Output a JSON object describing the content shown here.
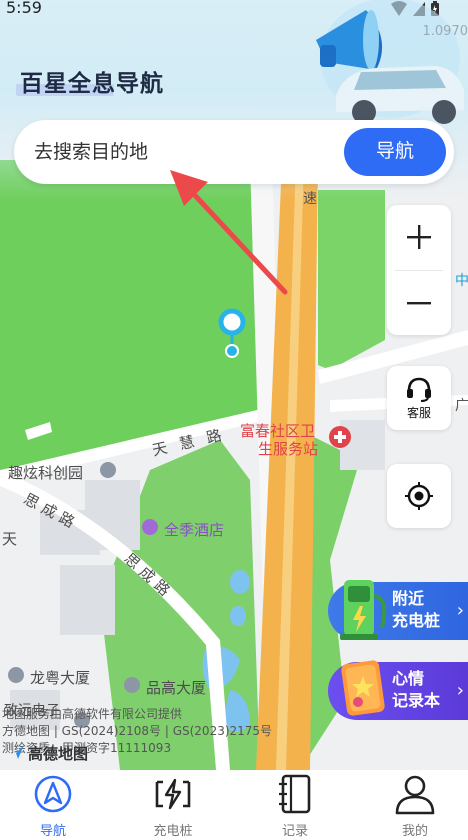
{
  "status_bar": {
    "time": "5:59"
  },
  "app": {
    "title": "百星全息导航",
    "version_text": "1.0970"
  },
  "search": {
    "placeholder": "去搜索目的地",
    "nav_button": "导航"
  },
  "map_controls": {
    "zoom_in": "+",
    "zoom_out": "−",
    "service_label": "客服"
  },
  "promos": {
    "charging": {
      "line1": "附近",
      "line2": "充电桩"
    },
    "mood": {
      "line1": "心情",
      "line2": "记录本"
    }
  },
  "map_labels": {
    "road_speed": "速",
    "tianhui_road": "天 慧 路",
    "fuchun_clinic_1": "富春社区卫",
    "fuchun_clinic_2": "生服务站",
    "quxuan_park": "趣炫科创园",
    "sicheng_road_1": "思成路",
    "sicheng_road_2": "思成路",
    "sicheng_road_3": "思成路",
    "tian_road": "天",
    "quanji_hotel": "全季酒店",
    "longyue_building": "龙粤大厦",
    "pingao_building": "品高大厦",
    "zhiyuan_electronics": "致远电子",
    "right_edge_1": "中",
    "right_edge_2": "广"
  },
  "map_attribution": {
    "line1": "地图服务由高德软件有限公司提供",
    "line2": "方德地图 | GS(2024)2108号 | GS(2023)2175号",
    "line3": "测绘资质：甲测资字11111093",
    "logo_text": "高德地图"
  },
  "tabs": [
    {
      "label": "导航",
      "icon": "navigation-arrow-icon",
      "active": true
    },
    {
      "label": "充电桩",
      "icon": "charging-bolt-icon",
      "active": false
    },
    {
      "label": "记录",
      "icon": "notebook-icon",
      "active": false
    },
    {
      "label": "我的",
      "icon": "person-icon",
      "active": false
    }
  ],
  "colors": {
    "accent": "#2f6cf6",
    "green": "#5cb85c",
    "road_orange": "#f0b04a"
  }
}
